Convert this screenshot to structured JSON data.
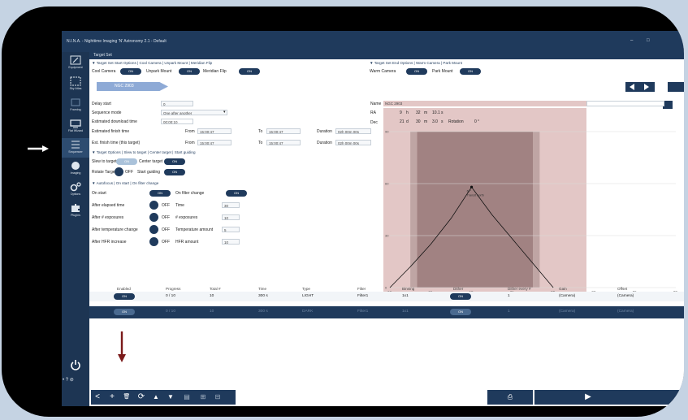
{
  "app": {
    "title": "N.I.N.A. - Nighttime Imaging 'N' Astronomy 2.1  -  Default",
    "window_controls": [
      "–",
      "□"
    ]
  },
  "sidebar": {
    "items": [
      {
        "label": "Equipment",
        "icon": "pencil-icon"
      },
      {
        "label": "Sky Atlas",
        "icon": "sky-atlas-icon"
      },
      {
        "label": "Framing",
        "icon": "framing-icon"
      },
      {
        "label": "Flat Wizard",
        "icon": "flat-wizard-icon"
      },
      {
        "label": "Sequencer",
        "icon": "sequencer-icon"
      },
      {
        "label": "Imaging",
        "icon": "imaging-icon"
      },
      {
        "label": "Options",
        "icon": "options-gears-icon"
      },
      {
        "label": "Plugins",
        "icon": "plugins-puzzle-icon"
      }
    ],
    "power_icon": "power-icon",
    "bottom_glyphs": "• ? ⊘"
  },
  "tab": {
    "label": "Target Set"
  },
  "start_options": {
    "header": "▼ Target Set Start Options  |  Cool Camera  |  Unpark Mount  |  Meridian Flip",
    "cool_camera_label": "Cool Camera",
    "unpark_mount_label": "Unpark Mount",
    "meridian_flip_label": "Meridian Flip",
    "on": "ON"
  },
  "end_options": {
    "header": "▼ Target Set End Options  |  Warm Camera  |  Park Mount",
    "warm_camera_label": "Warm Camera",
    "park_mount_label": "Park Mount",
    "on": "ON"
  },
  "target": {
    "tab_label": "NGC 2903"
  },
  "settings": {
    "delay_start_label": "Delay start",
    "delay_start_value": "0",
    "sequence_mode_label": "Sequence mode",
    "sequence_mode_value": "One after another",
    "est_download_label": "Estimated download time",
    "est_download_value": "00:00:10",
    "est_finish_label": "Estimated finish time",
    "from_label": "From",
    "from_value": "15:00:47",
    "to_label": "To",
    "to_value": "15:00:47",
    "duration_label": "Duration",
    "duration_value": "02h 00m 00s",
    "est_finish_target_label": "Est. finish time (this target)",
    "from_value_2": "15:00:47",
    "to_value_2": "15:00:47",
    "duration_value_2": "02h 00m 00s"
  },
  "target_options": {
    "header": "▼ Target Options  |  Slew to target  |  Center target  |  Start guiding",
    "slew_label": "Slew to target",
    "center_label": "Center target",
    "rotate_label": "Rotate Target",
    "off": "OFF",
    "start_guiding_label": "Start guiding",
    "on": "ON"
  },
  "autofocus": {
    "header": "▼ Autofocus  |  On start  |  On filter change",
    "on_start_label": "On start",
    "on_filter_change_label": "On filter change",
    "after_elapsed_label": "After elapsed time",
    "time_label": "Time",
    "time_value": "30",
    "after_exposures_label": "After # exposures",
    "exposures_label": "# exposures",
    "exposures_value": "10",
    "after_temp_label": "After temperature change",
    "temp_label": "Temperature amount",
    "temp_value": "5",
    "after_hfr_label": "After HFR increase",
    "hfr_label": "HFR amount",
    "hfr_value": "10",
    "off": "OFF",
    "on": "ON"
  },
  "coords": {
    "name_label": "Name",
    "name_value": "NGC 2903",
    "ra_label": "RA",
    "ra_h": "9",
    "ra_h_unit": "h",
    "ra_m": "32",
    "ra_m_unit": "m",
    "ra_s": "10.1",
    "ra_s_unit": "s",
    "dec_label": "Dec",
    "dec_d": "21",
    "dec_d_unit": "d",
    "dec_m": "30",
    "dec_m_unit": "m",
    "dec_s": "3.0",
    "dec_s_unit": "s",
    "rotation_label": "Rotation",
    "rotation_value": "0 °"
  },
  "chart_data": {
    "type": "line",
    "title": "",
    "xlabel": "",
    "ylabel": "",
    "x_ticks": [
      "12",
      "15",
      "18",
      "21",
      "00",
      "03",
      "06",
      "09"
    ],
    "y_ticks": [
      "0",
      "30",
      "60",
      "90"
    ],
    "ylim": [
      0,
      90
    ],
    "series": [
      {
        "x": [
          12,
          13.5,
          15,
          16.5,
          18,
          19.5,
          21,
          22.5,
          24
        ],
        "y": [
          0,
          12,
          25,
          40,
          58,
          42,
          28,
          14,
          0
        ]
      }
    ],
    "annotation": "67°\nTransit north",
    "peak": {
      "x": 18,
      "y": 58
    },
    "shaded_bands": [
      [
        13.5,
        14
      ],
      [
        14,
        22.5
      ],
      [
        22.5,
        23
      ]
    ],
    "grid": true
  },
  "table": {
    "headers": [
      "Enabled",
      "Progress",
      "Total #",
      "Time",
      "Type",
      "Filter",
      "Binning",
      "Dither",
      "Dither every #",
      "Gain",
      "Offset"
    ],
    "rows": [
      [
        "ON",
        "0 / 10",
        "10",
        "300 s",
        "LIGHT",
        "Filter1",
        "1x1",
        "ON",
        "1",
        "(Camera)",
        "(Camera)"
      ],
      [
        "ON",
        "0 / 10",
        "10",
        "300 s",
        "DARK",
        "Filter1",
        "1x1",
        "ON",
        "1",
        "(Camera)",
        "(Camera)"
      ]
    ]
  },
  "toolbar": {
    "left_buttons": [
      "<",
      "+",
      "🗑",
      "⟳",
      "▲",
      "▼",
      "▤",
      "⊞",
      "⊟"
    ],
    "right_buttons": [
      "⎙",
      "▶"
    ]
  },
  "annotations_colors": {
    "arrow_white": "#ffffff",
    "arrow_red": "#7b1a1a",
    "chart_bg": "#e3c7c6",
    "shade": "#8b6b6b",
    "shade_light": "#a68d8d",
    "navy": "#1f3a5c"
  }
}
